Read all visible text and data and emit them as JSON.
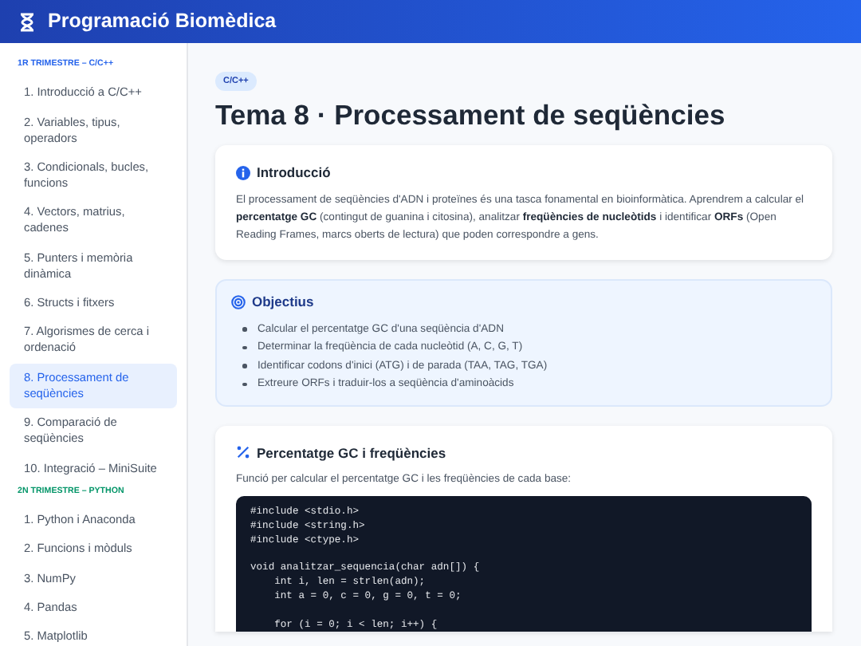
{
  "header": {
    "title": "Programació Biomèdica"
  },
  "sidebar": {
    "sections": [
      {
        "label": "1R TRIMESTRE – C/C++",
        "color": "#2563eb",
        "items": [
          {
            "label": "1. Introducció a C/C++",
            "selected": false
          },
          {
            "label": "2. Variables, tipus, operadors",
            "selected": false
          },
          {
            "label": "3. Condicionals, bucles, funcions",
            "selected": false
          },
          {
            "label": "4. Vectors, matrius, cadenes",
            "selected": false
          },
          {
            "label": "5. Punters i memòria dinàmica",
            "selected": false
          },
          {
            "label": "6. Structs i fitxers",
            "selected": false
          },
          {
            "label": "7. Algorismes de cerca i ordenació",
            "selected": false
          },
          {
            "label": "8. Processament de seqüències",
            "selected": true
          },
          {
            "label": "9. Comparació de seqüències",
            "selected": false
          },
          {
            "label": "10. Integració – MiniSuite",
            "selected": false
          }
        ]
      },
      {
        "label": "2N TRIMESTRE – PYTHON",
        "color": "#059669",
        "items": [
          {
            "label": "1. Python i Anaconda",
            "selected": false
          },
          {
            "label": "2. Funcions i mòduls",
            "selected": false
          },
          {
            "label": "3. NumPy",
            "selected": false
          },
          {
            "label": "4. Pandas",
            "selected": false
          },
          {
            "label": "5. Matplotlib",
            "selected": false
          }
        ]
      }
    ]
  },
  "main": {
    "badge": "C/C++",
    "title": "Tema 8 · Processament de seqüències",
    "sections": [
      {
        "kind": "intro",
        "title": "Introducció",
        "text": "El processament de seqüències d'ADN i proteïnes és una tasca fonamental en bioinformàtica. Aprendrem a calcular el **percentatge GC** (contingut de guanina i citosina), analitzar **freqüències de nucleòtids** i identificar **ORFs** (Open Reading Frames, marcs oberts de lectura) que poden correspondre a gens."
      },
      {
        "kind": "objectives",
        "title": "Objectius",
        "items": [
          "Calcular el percentatge GC d'una seqüència d'ADN",
          "Determinar la freqüència de cada nucleòtid (A, C, G, T)",
          "Identificar codons d'inici (ATG) i de parada (TAA, TAG, TGA)",
          "Extreure ORFs i traduir-los a seqüència d'aminoàcids"
        ]
      },
      {
        "kind": "code",
        "title": "Percentatge GC i freqüències",
        "description": "Funció per calcular el percentatge GC i les freqüències de cada base:",
        "code": "#include <stdio.h>\n#include <string.h>\n#include <ctype.h>\n\nvoid analitzar_sequencia(char adn[]) {\n    int i, len = strlen(adn);\n    int a = 0, c = 0, g = 0, t = 0;\n\n    for (i = 0; i < len; i++) {"
      }
    ]
  }
}
